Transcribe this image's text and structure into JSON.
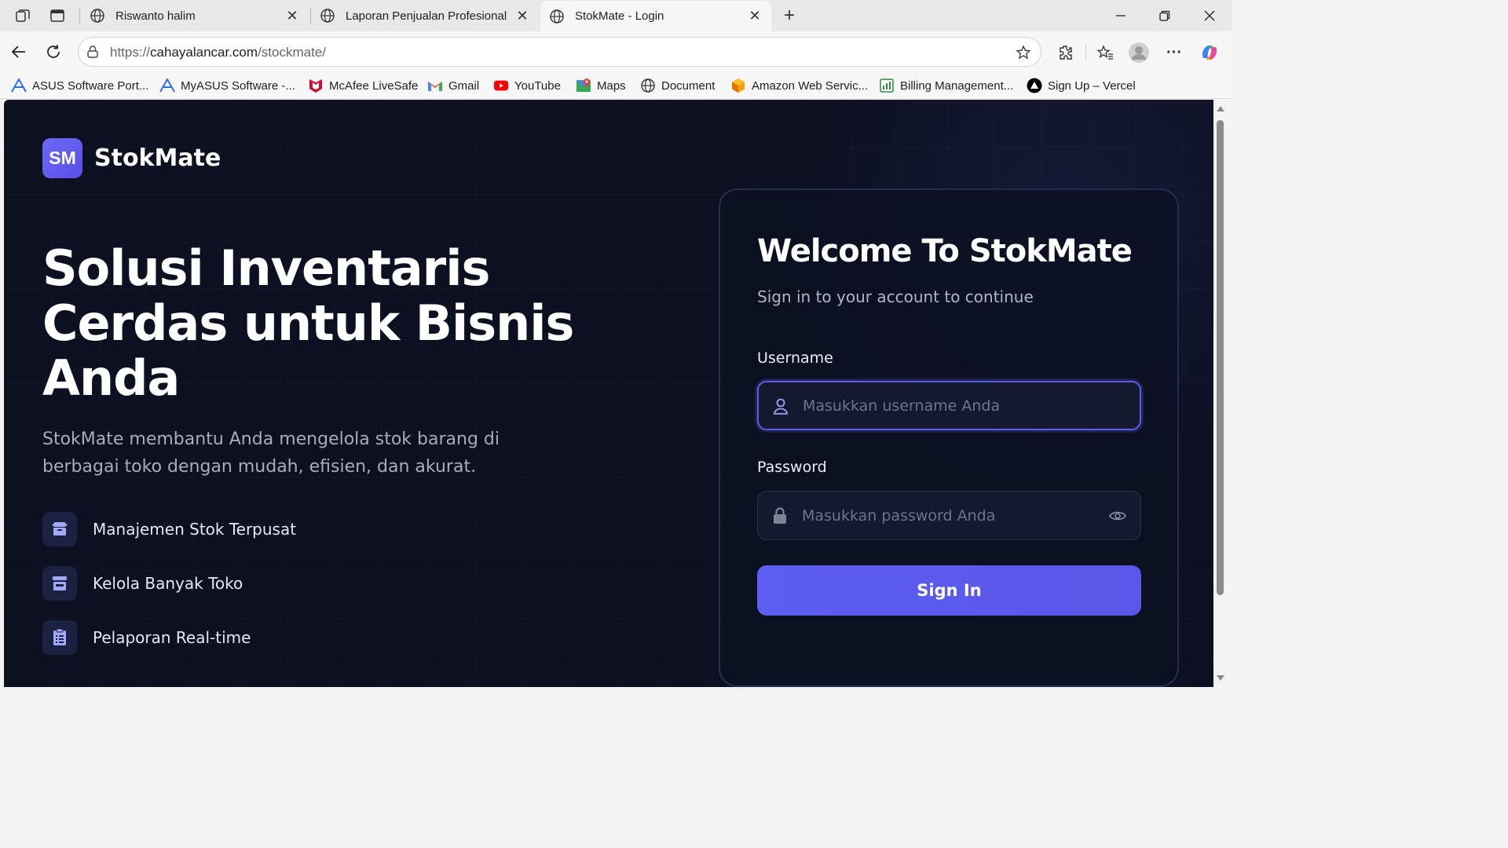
{
  "browser": {
    "tabs": [
      {
        "title": "Riswanto halim",
        "active": false
      },
      {
        "title": "Laporan Penjualan Profesional",
        "active": false
      },
      {
        "title": "StokMate - Login",
        "active": true
      }
    ],
    "url_prefix": "https://",
    "url_domain": "cahayalancar.com",
    "url_path": "/stockmate/",
    "bookmarks": [
      {
        "label": "ASUS Software Port...",
        "icon": "asus-icon"
      },
      {
        "label": "MyASUS Software -...",
        "icon": "asus-icon"
      },
      {
        "label": "McAfee LiveSafe",
        "icon": "mcafee-icon"
      },
      {
        "label": "Gmail",
        "icon": "gmail-icon"
      },
      {
        "label": "YouTube",
        "icon": "youtube-icon"
      },
      {
        "label": "Maps",
        "icon": "maps-icon"
      },
      {
        "label": "Document",
        "icon": "globe-icon"
      },
      {
        "label": "Amazon Web Servic...",
        "icon": "aws-icon"
      },
      {
        "label": "Billing Management...",
        "icon": "billing-icon"
      },
      {
        "label": "Sign Up – Vercel",
        "icon": "vercel-icon"
      }
    ]
  },
  "page": {
    "logo_badge": "SM",
    "logo_text": "StokMate",
    "hero_title": "Solusi Inventaris Cerdas untuk Bisnis Anda",
    "hero_subtitle": "StokMate membantu Anda mengelola stok barang di berbagai toko dengan mudah, efisien, dan akurat.",
    "features": [
      {
        "label": "Manajemen Stok Terpusat",
        "icon": "box-icon"
      },
      {
        "label": "Kelola Banyak Toko",
        "icon": "store-icon"
      },
      {
        "label": "Pelaporan Real-time",
        "icon": "clipboard-icon"
      }
    ],
    "login": {
      "title": "Welcome To StokMate",
      "subtitle": "Sign in to your account to continue",
      "username_label": "Username",
      "username_placeholder": "Masukkan username Anda",
      "password_label": "Password",
      "password_placeholder": "Masukkan password Anda",
      "submit_label": "Sign In"
    }
  },
  "colors": {
    "background": "#0c1020",
    "accent": "#5b5ef0",
    "card_border": "#262d52"
  }
}
